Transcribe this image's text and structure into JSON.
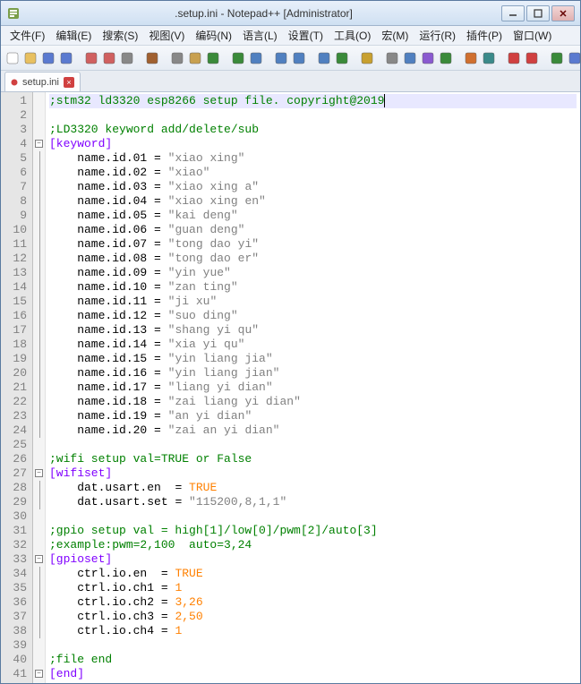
{
  "window": {
    "title": ".setup.ini - Notepad++ [Administrator]"
  },
  "menus": [
    "文件(F)",
    "编辑(E)",
    "搜索(S)",
    "视图(V)",
    "编码(N)",
    "语言(L)",
    "设置(T)",
    "工具(O)",
    "宏(M)",
    "运行(R)",
    "插件(P)",
    "窗口(W)"
  ],
  "tab": {
    "label": "setup.ini"
  },
  "lines": [
    {
      "n": 1,
      "type": "comment",
      "hl": true,
      "caret": true,
      "fold": "",
      "text": ";stm32 ld3320 esp8266 setup file. copyright@2019"
    },
    {
      "n": 2,
      "type": "blank",
      "fold": "",
      "text": ""
    },
    {
      "n": 3,
      "type": "comment",
      "fold": "",
      "text": ";LD3320 keyword add/delete/sub"
    },
    {
      "n": 4,
      "type": "section",
      "fold": "box",
      "text": "[keyword]"
    },
    {
      "n": 5,
      "type": "kv",
      "fold": "line",
      "k": "    name.id.01 ",
      "v": "\"xiao xing\""
    },
    {
      "n": 6,
      "type": "kv",
      "fold": "line",
      "k": "    name.id.02 ",
      "v": "\"xiao\""
    },
    {
      "n": 7,
      "type": "kv",
      "fold": "line",
      "k": "    name.id.03 ",
      "v": "\"xiao xing a\""
    },
    {
      "n": 8,
      "type": "kv",
      "fold": "line",
      "k": "    name.id.04 ",
      "v": "\"xiao xing en\""
    },
    {
      "n": 9,
      "type": "kv",
      "fold": "line",
      "k": "    name.id.05 ",
      "v": "\"kai deng\""
    },
    {
      "n": 10,
      "type": "kv",
      "fold": "line",
      "k": "    name.id.06 ",
      "v": "\"guan deng\""
    },
    {
      "n": 11,
      "type": "kv",
      "fold": "line",
      "k": "    name.id.07 ",
      "v": "\"tong dao yi\""
    },
    {
      "n": 12,
      "type": "kv",
      "fold": "line",
      "k": "    name.id.08 ",
      "v": "\"tong dao er\""
    },
    {
      "n": 13,
      "type": "kv",
      "fold": "line",
      "k": "    name.id.09 ",
      "v": "\"yin yue\""
    },
    {
      "n": 14,
      "type": "kv",
      "fold": "line",
      "k": "    name.id.10 ",
      "v": "\"zan ting\""
    },
    {
      "n": 15,
      "type": "kv",
      "fold": "line",
      "k": "    name.id.11 ",
      "v": "\"ji xu\""
    },
    {
      "n": 16,
      "type": "kv",
      "fold": "line",
      "k": "    name.id.12 ",
      "v": "\"suo ding\""
    },
    {
      "n": 17,
      "type": "kv",
      "fold": "line",
      "k": "    name.id.13 ",
      "v": "\"shang yi qu\""
    },
    {
      "n": 18,
      "type": "kv",
      "fold": "line",
      "k": "    name.id.14 ",
      "v": "\"xia yi qu\""
    },
    {
      "n": 19,
      "type": "kv",
      "fold": "line",
      "k": "    name.id.15 ",
      "v": "\"yin liang jia\""
    },
    {
      "n": 20,
      "type": "kv",
      "fold": "line",
      "k": "    name.id.16 ",
      "v": "\"yin liang jian\""
    },
    {
      "n": 21,
      "type": "kv",
      "fold": "line",
      "k": "    name.id.17 ",
      "v": "\"liang yi dian\""
    },
    {
      "n": 22,
      "type": "kv",
      "fold": "line",
      "k": "    name.id.18 ",
      "v": "\"zai liang yi dian\""
    },
    {
      "n": 23,
      "type": "kv",
      "fold": "line",
      "k": "    name.id.19 ",
      "v": "\"an yi dian\""
    },
    {
      "n": 24,
      "type": "kv",
      "fold": "line",
      "k": "    name.id.20 ",
      "v": "\"zai an yi dian\""
    },
    {
      "n": 25,
      "type": "blank",
      "fold": "",
      "text": ""
    },
    {
      "n": 26,
      "type": "comment",
      "fold": "",
      "text": ";wifi setup val=TRUE or False"
    },
    {
      "n": 27,
      "type": "section",
      "fold": "box",
      "text": "[wifiset]"
    },
    {
      "n": 28,
      "type": "kvnum",
      "fold": "line",
      "k": "    dat.usart.en  ",
      "v": "TRUE"
    },
    {
      "n": 29,
      "type": "kv",
      "fold": "line",
      "k": "    dat.usart.set ",
      "v": "\"115200,8,1,1\""
    },
    {
      "n": 30,
      "type": "blank",
      "fold": "",
      "text": ""
    },
    {
      "n": 31,
      "type": "comment",
      "fold": "",
      "text": ";gpio setup val = high[1]/low[0]/pwm[2]/auto[3]"
    },
    {
      "n": 32,
      "type": "comment",
      "fold": "",
      "text": ";example:pwm=2,100  auto=3,24"
    },
    {
      "n": 33,
      "type": "section",
      "fold": "box",
      "text": "[gpioset]"
    },
    {
      "n": 34,
      "type": "kvnum",
      "fold": "line",
      "k": "    ctrl.io.en  ",
      "v": "TRUE"
    },
    {
      "n": 35,
      "type": "kvnum",
      "fold": "line",
      "k": "    ctrl.io.ch1 ",
      "v": "1"
    },
    {
      "n": 36,
      "type": "kvnum",
      "fold": "line",
      "k": "    ctrl.io.ch2 ",
      "v": "3,26"
    },
    {
      "n": 37,
      "type": "kvnum",
      "fold": "line",
      "k": "    ctrl.io.ch3 ",
      "v": "2,50"
    },
    {
      "n": 38,
      "type": "kvnum",
      "fold": "line",
      "k": "    ctrl.io.ch4 ",
      "v": "1"
    },
    {
      "n": 39,
      "type": "blank",
      "fold": "",
      "text": ""
    },
    {
      "n": 40,
      "type": "comment",
      "fold": "",
      "text": ";file end"
    },
    {
      "n": 41,
      "type": "section",
      "fold": "box",
      "text": "[end]"
    }
  ],
  "toolbar_icons": [
    "new",
    "open",
    "save",
    "save-all",
    "close",
    "close-all",
    "print",
    "cut",
    "copy",
    "paste",
    "undo",
    "redo",
    "find",
    "replace",
    "zoom-in",
    "zoom-out",
    "sync",
    "wrap",
    "ws",
    "indent",
    "lang",
    "folder",
    "func",
    "comment",
    "hide",
    "record",
    "play",
    "map",
    "doc",
    "eye"
  ]
}
